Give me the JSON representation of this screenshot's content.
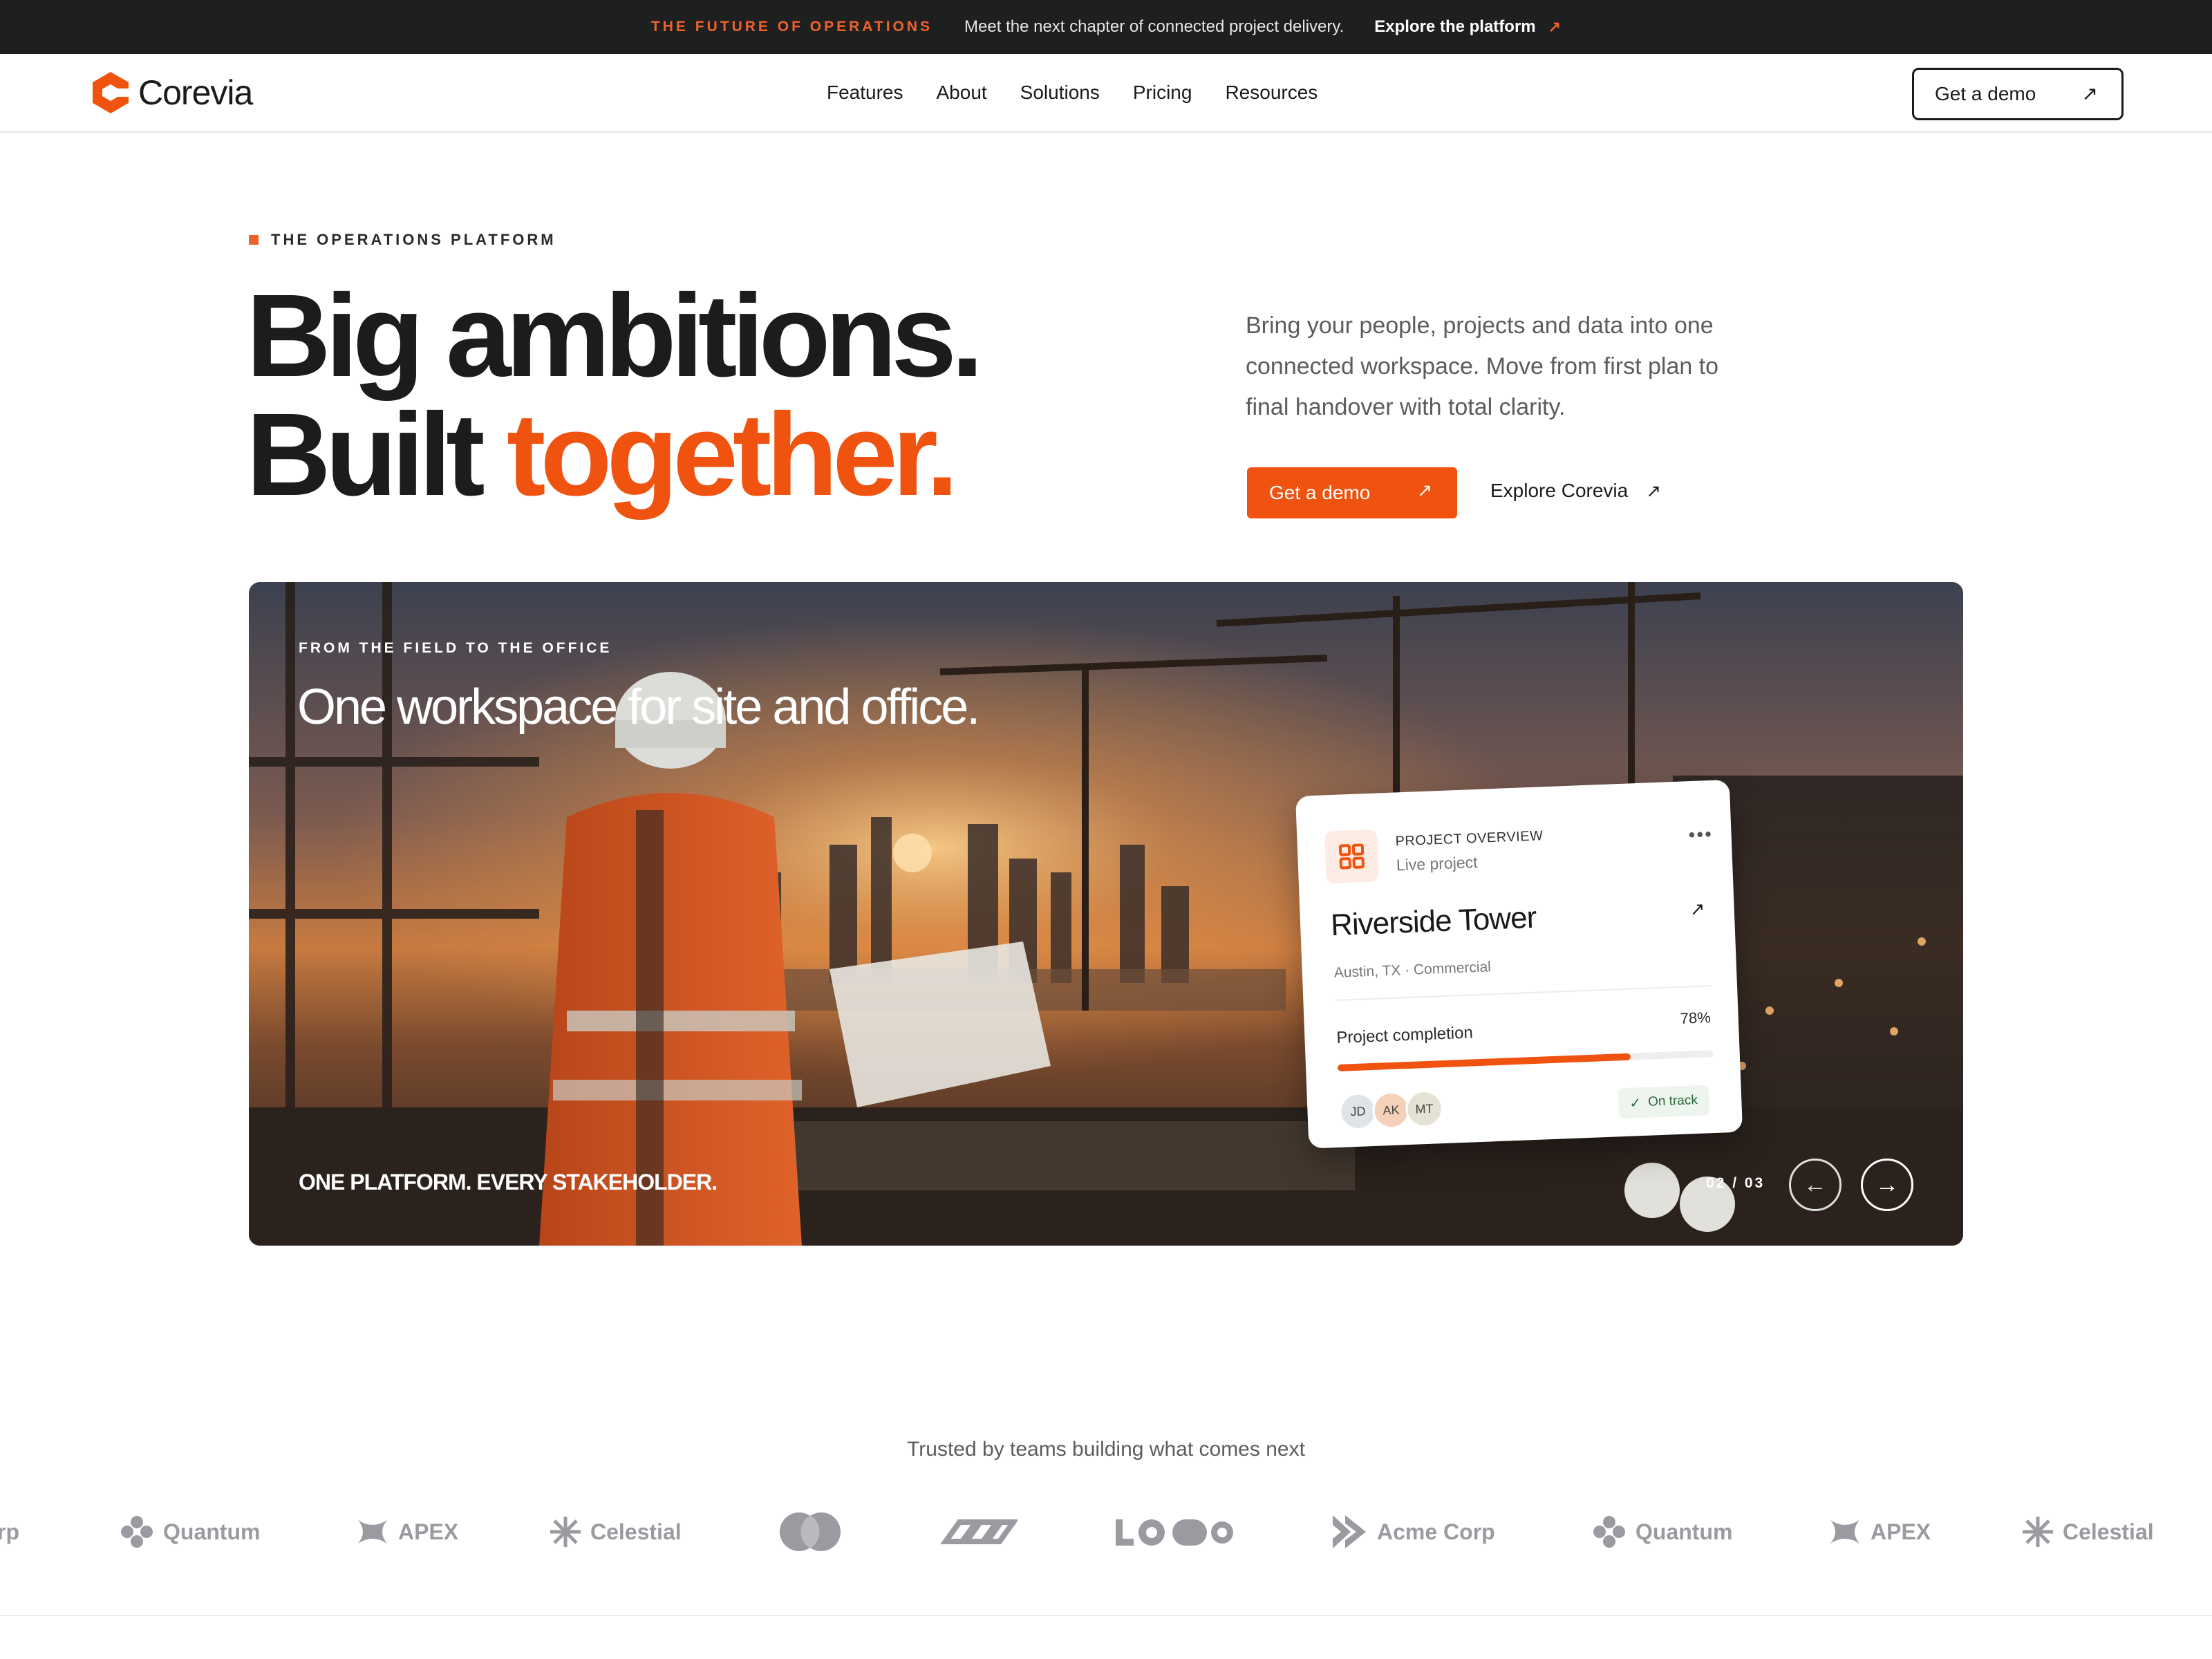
{
  "announcement": {
    "eyebrow": "THE FUTURE OF OPERATIONS",
    "text": "Meet the next chapter of connected project delivery.",
    "link": "Explore the platform"
  },
  "brand": {
    "name": "Corevia",
    "accent": "#f0530f"
  },
  "nav": {
    "links": [
      "Features",
      "About",
      "Solutions",
      "Pricing",
      "Resources"
    ],
    "cta": "Get a demo"
  },
  "hero": {
    "eyebrow": "THE OPERATIONS PLATFORM",
    "headline_line1": "Big ambitions.",
    "headline_line2_prefix": "Built ",
    "headline_line2_accent": "together.",
    "lede": "Bring your people, projects and data into one connected workspace. Move from first plan to final handover with total clarity.",
    "primary_cta": "Get a demo",
    "secondary_cta": "Explore Corevia"
  },
  "slide": {
    "eyebrow": "FROM THE FIELD TO THE OFFICE",
    "title": "One workspace for site and office.",
    "footer": "ONE PLATFORM. EVERY STAKEHOLDER.",
    "pager": "02 / 03"
  },
  "project_card": {
    "label": "PROJECT OVERVIEW",
    "sub": "Live project",
    "title": "Riverside Tower",
    "meta": "Austin, TX · Commercial",
    "progress_label": "Project completion",
    "progress_text": "78%",
    "progress": 0.78,
    "avatars": [
      "JD",
      "AK",
      "MT"
    ],
    "status": "On track"
  },
  "trusted": {
    "heading": "Trusted by teams building what comes next",
    "logos": [
      "rp",
      "Quantum",
      "APEX",
      "Celestial",
      "",
      "",
      "",
      "Acme Corp",
      "Quantum",
      "APEX",
      "Celestial"
    ]
  },
  "icons": {
    "announcement_arrow": "arrow-up-right-icon",
    "card_icon": "grid-icon",
    "prev": "arrow-left-icon",
    "next": "arrow-right-icon"
  }
}
